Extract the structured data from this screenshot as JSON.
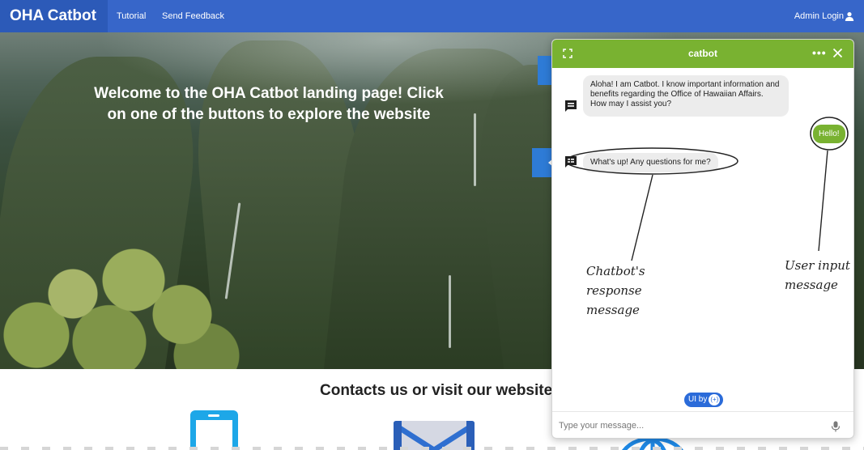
{
  "navbar": {
    "brand": "OHA Catbot",
    "links": [
      "Tutorial",
      "Send Feedback"
    ],
    "admin_label": "Admin Login"
  },
  "hero": {
    "title": "Welcome to the OHA Catbot landing page! Click on one of the buttons to explore the website"
  },
  "contacts": {
    "title": "Contacts us or visit our website!",
    "icons": [
      "phone-icon",
      "mail-icon",
      "globe-icon"
    ]
  },
  "chat": {
    "title": "catbot",
    "messages": [
      {
        "from": "bot",
        "text": "Aloha! I am Catbot. I know important information and benefits regarding the Office of Hawaiian Affairs. How may I assist you?"
      },
      {
        "from": "user",
        "text": "Hello!"
      },
      {
        "from": "bot",
        "text": "What's up! Any questions for me?"
      }
    ],
    "ui_by": "UI by",
    "input_placeholder": "Type your message...",
    "header_color": "#79b231"
  },
  "annotations": {
    "bot_note": "Chatbot's response message",
    "user_note": "User input message"
  },
  "colors": {
    "navbar": "#3766c9",
    "chat_accent": "#79b231",
    "side_buttons": "#2e7bd6"
  }
}
